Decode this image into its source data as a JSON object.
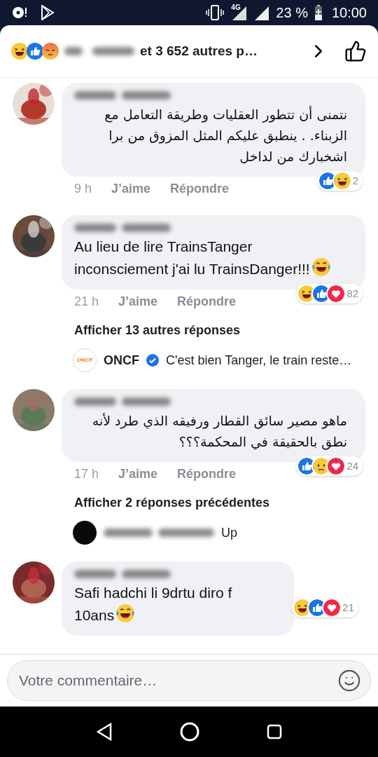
{
  "status_bar": {
    "network": "4G",
    "battery": "23 %",
    "time": "10:00"
  },
  "header": {
    "reactions": [
      {
        "kind": "haha"
      },
      {
        "kind": "like"
      },
      {
        "kind": "angry"
      }
    ],
    "summary": "et 3 652 autres p…"
  },
  "comments": [
    {
      "kind": "rtl",
      "text": "نتمنى أن تتطور العقليات وطريقة التعامل مع الزبناء. . ينطبق عليكم المثل المزوق من برا اشخبارك من لداخل",
      "time": "9 h",
      "like": "J’aime",
      "reply": "Répondre",
      "reactions": [
        {
          "kind": "like"
        },
        {
          "kind": "haha"
        }
      ],
      "count": "2"
    },
    {
      "kind": "ltr",
      "text": "Au lieu de lire TrainsTanger inconsciement j'ai lu TrainsDanger!!!",
      "emoji": {
        "kind": "tears_of_joy"
      },
      "time": "21 h",
      "like": "J’aime",
      "reply": "Répondre",
      "reactions": [
        {
          "kind": "haha"
        },
        {
          "kind": "like"
        },
        {
          "kind": "love"
        }
      ],
      "count": "82",
      "more": "Afficher 13 autres réponses",
      "preview": {
        "kind": "logo",
        "logo_text": "ONCF",
        "author": "ONCF",
        "verified": true,
        "text": "C'est bien Tanger, le train reste…"
      }
    },
    {
      "kind": "rtl",
      "text": "ماهو مصير سائق القطار ورفيقه الذي طرد لأنه نطق بالحقيقة في المحكمة؟؟؟",
      "time": "17 h",
      "like": "J’aime",
      "reply": "Répondre",
      "reactions": [
        {
          "kind": "like"
        },
        {
          "kind": "sad"
        },
        {
          "kind": "love"
        }
      ],
      "count": "24",
      "more": "Afficher 2 réponses précédentes",
      "preview": {
        "kind": "dark",
        "verified": false,
        "text": "Up"
      }
    },
    {
      "kind": "ltr",
      "text": "Safi hadchi li 9drtu diro f 10ans",
      "emoji": {
        "kind": "tears_of_joy"
      },
      "reactions": [
        {
          "kind": "haha"
        },
        {
          "kind": "like"
        },
        {
          "kind": "love"
        }
      ],
      "count": "21",
      "short": true
    }
  ],
  "composer": {
    "placeholder": "Votre commentaire…"
  }
}
